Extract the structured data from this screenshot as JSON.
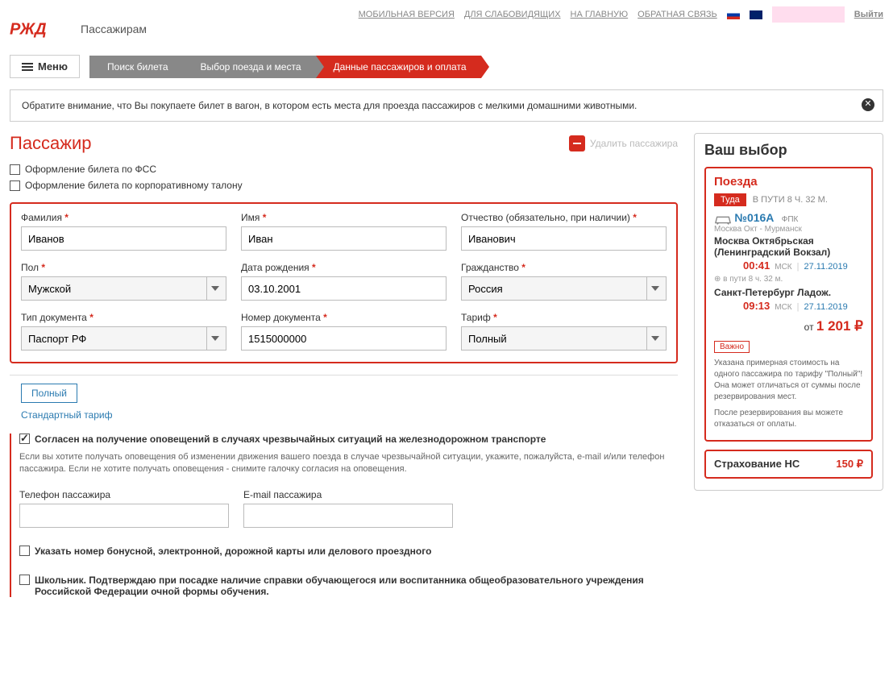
{
  "header": {
    "links": [
      "МОБИЛЬНАЯ ВЕРСИЯ",
      "ДЛЯ СЛАБОВИДЯЩИХ",
      "НА ГЛАВНУЮ",
      "ОБРАТНАЯ СВЯЗЬ"
    ],
    "logout": "Выйти",
    "logo_sub": "Пассажирам",
    "menu": "Меню"
  },
  "steps": [
    "Поиск билета",
    "Выбор поезда и места",
    "Данные пассажиров и оплата"
  ],
  "notice": "Обратите внимание, что Вы покупаете билет в вагон, в котором есть места для проезда пассажиров с мелкими домашними животными.",
  "passenger": {
    "title": "Пассажир",
    "delete": "Удалить пассажира",
    "fss": "Оформление билета по ФСС",
    "corp": "Оформление билета по корпоративному талону"
  },
  "form": {
    "lastname": {
      "label": "Фамилия",
      "value": "Иванов"
    },
    "firstname": {
      "label": "Имя",
      "value": "Иван"
    },
    "middlename": {
      "label": "Отчество (обязательно, при наличии)",
      "value": "Иванович"
    },
    "gender": {
      "label": "Пол",
      "value": "Мужской"
    },
    "dob": {
      "label": "Дата рождения",
      "value": "03.10.2001"
    },
    "citizenship": {
      "label": "Гражданство",
      "value": "Россия"
    },
    "doctype": {
      "label": "Тип документа",
      "value": "Паспорт РФ"
    },
    "docnum": {
      "label": "Номер документа",
      "value": "1515000000"
    },
    "tariff": {
      "label": "Тариф",
      "value": "Полный"
    }
  },
  "tariff_box": {
    "tab": "Полный",
    "link": "Стандартный тариф"
  },
  "consent": {
    "label": "Согласен на получение оповещений в случаях чрезвычайных ситуаций на железнодорожном транспорте",
    "text": "Если вы хотите получать оповещения об изменении движения вашего поезда в случае чрезвычайной ситуации, укажите, пожалуйста, e-mail и/или телефон пассажира.\nЕсли не хотите получать оповещения - снимите галочку согласия на оповещения."
  },
  "contact": {
    "phone": "Телефон пассажира",
    "email": "E-mail пассажира"
  },
  "extras": {
    "bonus": "Указать номер бонусной, электронной, дорожной карты или делового проездного",
    "school": "Школьник. Подтверждаю при посадке наличие справки обучающегося или воспитанника общеобразовательного учреждения Российской Федерации очной формы обучения."
  },
  "side": {
    "title": "Ваш выбор",
    "trains": "Поезда",
    "dir": "Туда",
    "duration_top": "В ПУТИ 8 Ч. 32 М.",
    "train_num": "№016А",
    "company": "ФПК",
    "route": "Москва Окт - Мурманск",
    "from_station": "Москва Октябрьская (Ленинградский Вокзал)",
    "from_time": "00:41",
    "from_tz": "МСК",
    "from_date": "27.11.2019",
    "transit": "в пути  8 ч. 32 м.",
    "to_station": "Санкт-Петербург Ладож.",
    "to_time": "09:13",
    "to_tz": "МСК",
    "to_date": "27.11.2019",
    "price_from": "от",
    "price": "1 201 ₽",
    "important": "Важно",
    "note1": "Указана примерная стоимость на одного пассажира по тарифу \"Полный\"! Она может отличаться от суммы после резервирования мест.",
    "note2": "После резервирования вы можете отказаться от оплаты.",
    "insurance_label": "Страхование НС",
    "insurance_price": "150 ₽"
  }
}
